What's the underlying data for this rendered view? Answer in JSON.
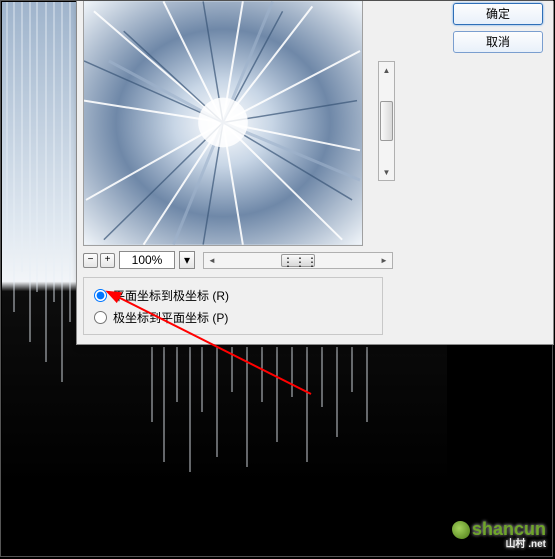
{
  "background": {
    "description": "wind/icicle texture artwork"
  },
  "dialog": {
    "buttons": {
      "ok": "确定",
      "cancel": "取消"
    },
    "zoom": {
      "value": "100%",
      "minus": "−",
      "plus": "+"
    },
    "options": {
      "rect_to_polar": "平面坐标到极坐标 (R)",
      "polar_to_rect": "极坐标到平面坐标 (P)",
      "selected": "rect_to_polar"
    }
  },
  "icons": {
    "chevron_down": "▾",
    "triangle_left": "◄",
    "triangle_right": "►",
    "triangle_up": "▲",
    "triangle_down": "▼",
    "grip": "⋮⋮⋮"
  },
  "annotation": {
    "arrow_color": "#ff0000"
  },
  "watermark": {
    "text": "shancun",
    "sub": "山村 .net"
  }
}
